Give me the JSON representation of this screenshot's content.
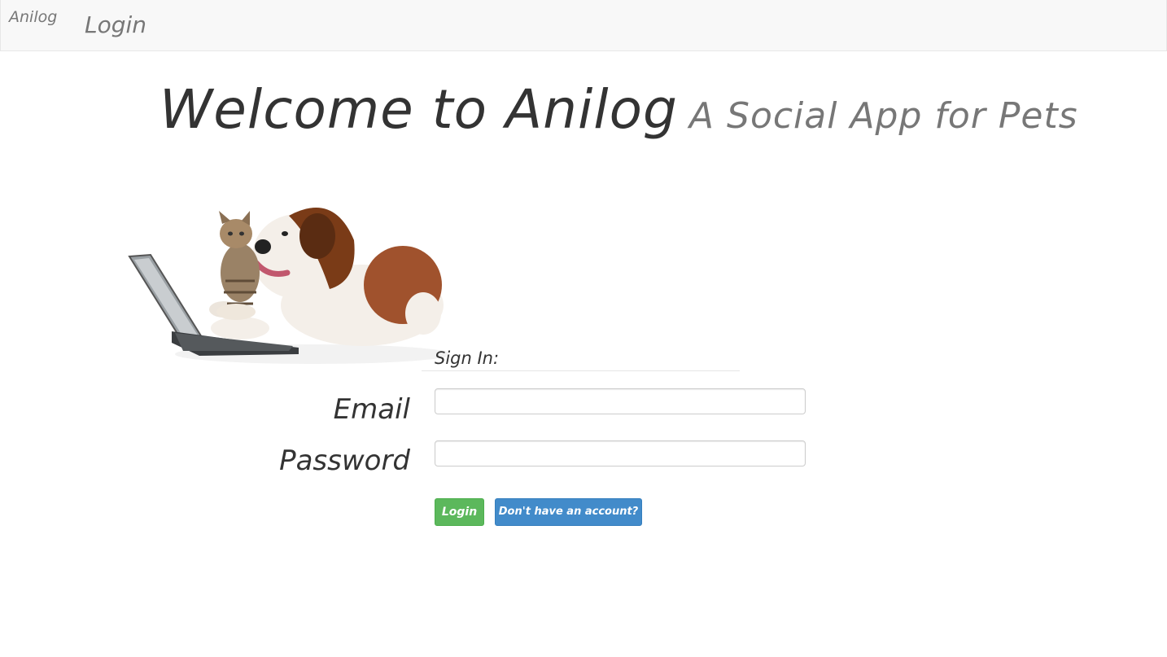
{
  "navbar": {
    "brand": "Anilog",
    "login_link": "Login"
  },
  "header": {
    "title": "Welcome to Anilog",
    "subtitle": "A Social App for Pets"
  },
  "hero_image": {
    "icon": "dog-and-cat-with-laptop-illustration"
  },
  "signin": {
    "legend": "Sign In:",
    "email_label": "Email",
    "email_value": "",
    "password_label": "Password",
    "password_value": "",
    "login_button": "Login",
    "signup_button": "Don't have an account?"
  },
  "colors": {
    "navbar_bg": "#f8f8f8",
    "success": "#5cb85c",
    "primary": "#428bca",
    "muted_text": "#777777"
  }
}
